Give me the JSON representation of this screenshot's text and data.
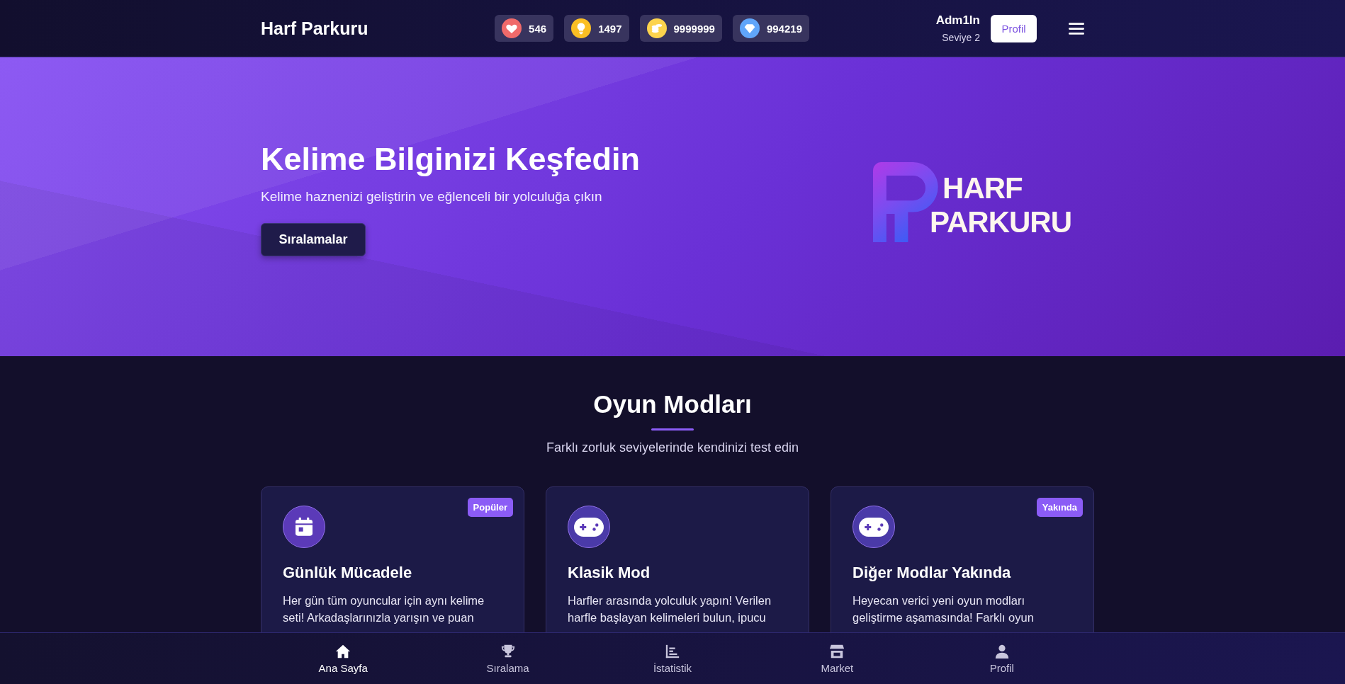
{
  "header": {
    "title": "Harf Parkuru",
    "stats": [
      {
        "kind": "heart",
        "value": "546"
      },
      {
        "kind": "bulb",
        "value": "1497"
      },
      {
        "kind": "coins",
        "value": "9999999"
      },
      {
        "kind": "diamond",
        "value": "994219"
      }
    ],
    "user": {
      "name": "Adm1ln",
      "level": "Seviye 2"
    },
    "profile_button": "Profil"
  },
  "hero": {
    "title": "Kelime Bilginizi Keşfedin",
    "subtitle": "Kelime haznenizi geliştirin ve eğlenceli bir yolculuğa çıkın",
    "button": "Sıralamalar",
    "logo_lines": [
      "HARF",
      "PARKURU"
    ]
  },
  "modes": {
    "title": "Oyun Modları",
    "subtitle": "Farklı zorluk seviyelerinde kendinizi test edin",
    "cards": [
      {
        "kind": "calendar",
        "badge": "Popüler",
        "title": "Günlük Mücadele",
        "description": "Her gün tüm oyuncular için aynı kelime seti! Arkadaşlarınızla yarışın ve puan"
      },
      {
        "kind": "gamepad",
        "title": "Klasik Mod",
        "description": "Harfler arasında yolculuk yapın! Verilen harfle başlayan kelimeleri bulun, ipucu"
      },
      {
        "kind": "gamepad",
        "badge": "Yakında",
        "title": "Diğer Modlar Yakında",
        "description": "Heyecan verici yeni oyun modları geliştirme aşamasında! Farklı oyun"
      }
    ]
  },
  "bottom_nav": [
    {
      "kind": "home",
      "label": "Ana Sayfa",
      "selected": true
    },
    {
      "kind": "trophy",
      "label": "Sıralama",
      "selected": false
    },
    {
      "kind": "chart",
      "label": "İstatistik",
      "selected": false
    },
    {
      "kind": "store",
      "label": "Market",
      "selected": false
    },
    {
      "kind": "user",
      "label": "Profil",
      "selected": false
    }
  ]
}
